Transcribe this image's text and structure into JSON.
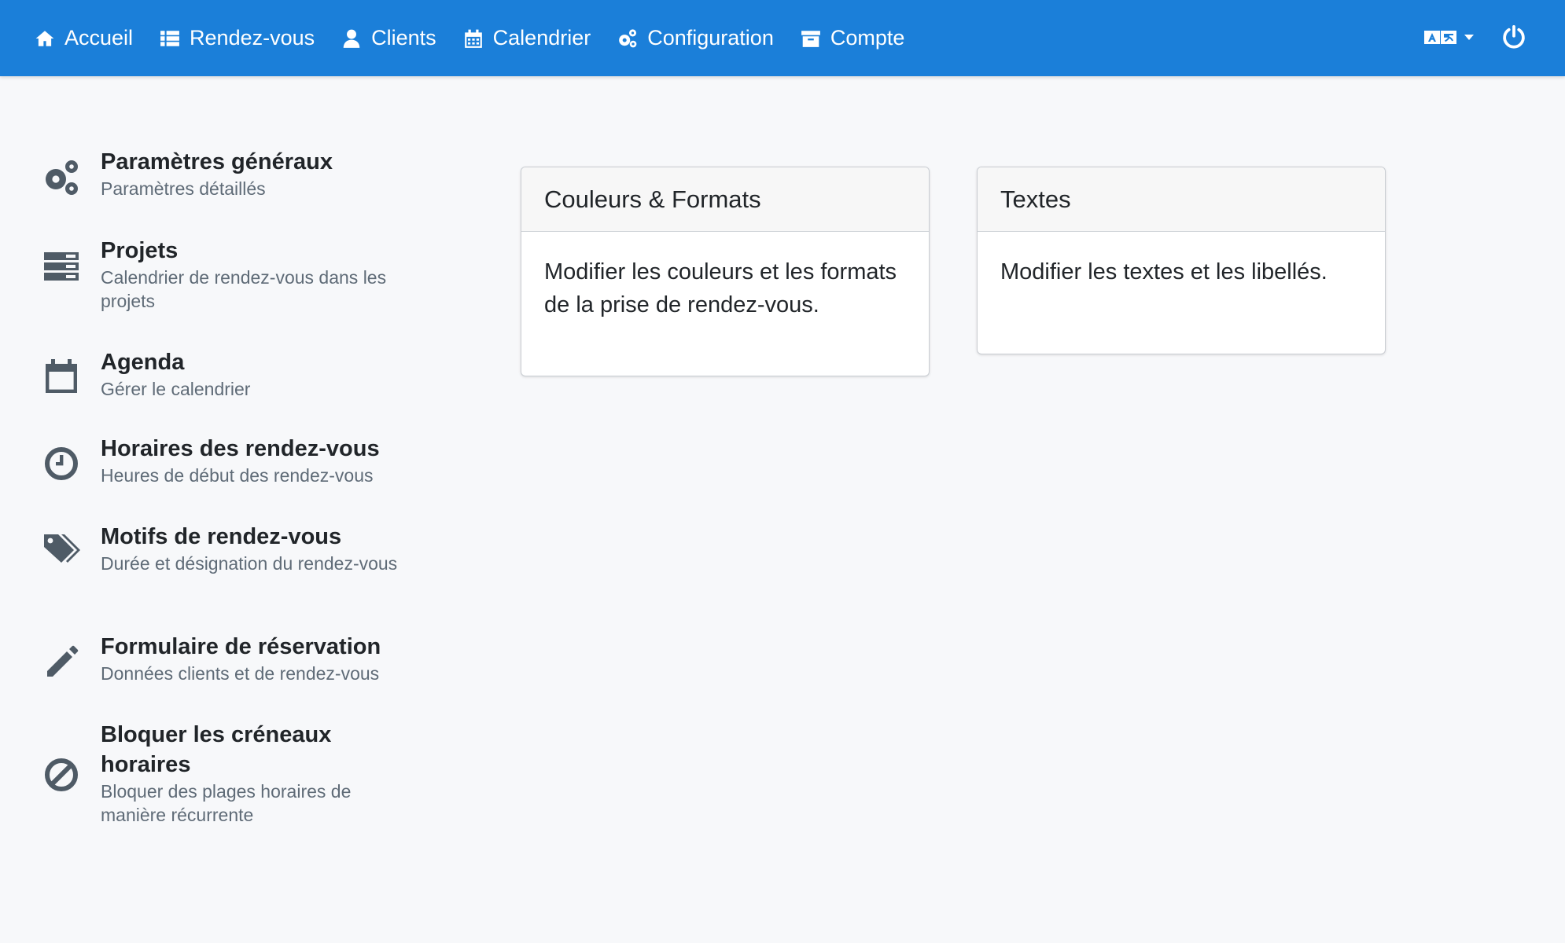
{
  "nav": {
    "items": [
      {
        "label": "Accueil",
        "icon": "home-icon"
      },
      {
        "label": "Rendez-vous",
        "icon": "list-icon"
      },
      {
        "label": "Clients",
        "icon": "user-icon"
      },
      {
        "label": "Calendrier",
        "icon": "calendar-icon"
      },
      {
        "label": "Configuration",
        "icon": "gears-icon"
      },
      {
        "label": "Compte",
        "icon": "archive-icon"
      }
    ],
    "language_icon": "language-icon",
    "power_icon": "power-icon"
  },
  "sidebar": {
    "items": [
      {
        "title": "Paramètres généraux",
        "subtitle": "Paramètres détaillés",
        "icon": "gears-icon"
      },
      {
        "title": "Projets",
        "subtitle": "Calendrier de rendez-vous dans les projets",
        "icon": "server-icon"
      },
      {
        "title": "Agenda",
        "subtitle": "Gérer le calendrier",
        "icon": "calendar-icon"
      },
      {
        "title": "Horaires des rendez-vous",
        "subtitle": "Heures de début des rendez-vous",
        "icon": "clock-icon"
      },
      {
        "title": "Motifs de rendez-vous",
        "subtitle": "Durée et désignation du rendez-vous",
        "icon": "tags-icon"
      },
      {
        "title": "Formulaire de réservation",
        "subtitle": "Données clients et de rendez-vous",
        "icon": "pencil-icon"
      },
      {
        "title": "Bloquer les créneaux horaires",
        "subtitle": "Bloquer des plages horaires de manière récurrente",
        "icon": "ban-icon"
      }
    ]
  },
  "cards": [
    {
      "title": "Couleurs & Formats",
      "body": "Modifier les couleurs et les formats de la prise de rendez-vous."
    },
    {
      "title": "Textes",
      "body": "Modifier les textes et les libellés."
    }
  ],
  "colors": {
    "navbar": "#1b7fd9",
    "background": "#f7f8fa",
    "icon": "#4f5b66"
  }
}
